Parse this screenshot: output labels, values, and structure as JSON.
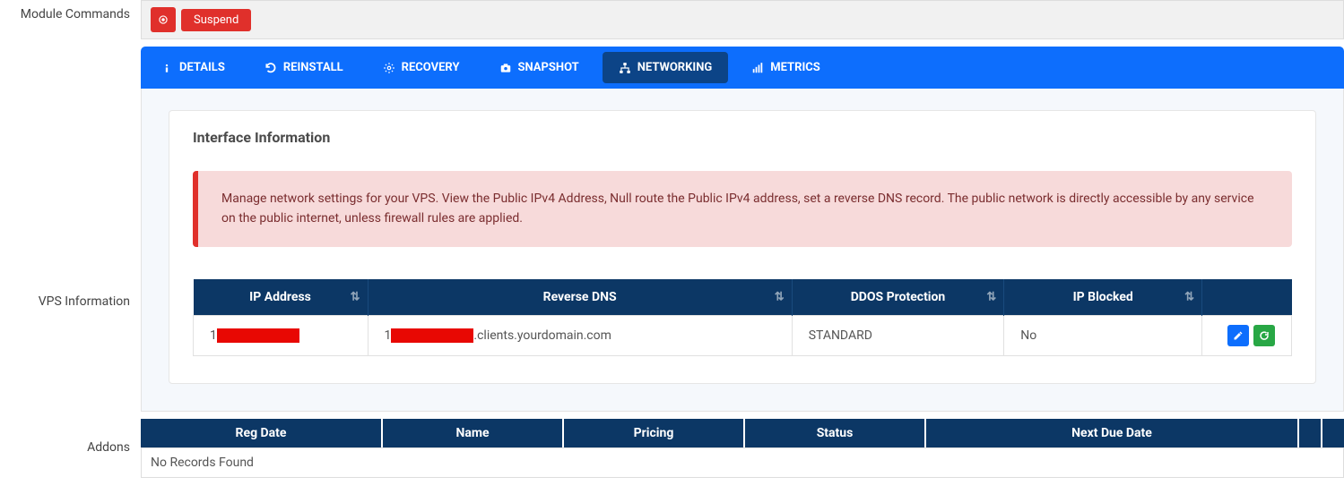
{
  "sections": {
    "module_commands": "Module Commands",
    "vps_information": "VPS Information",
    "addons": "Addons"
  },
  "commands": {
    "suspend": "Suspend"
  },
  "tabs": {
    "details": "DETAILS",
    "reinstall": "REINSTALL",
    "recovery": "RECOVERY",
    "snapshot": "SNAPSHOT",
    "networking": "NETWORKING",
    "metrics": "METRICS"
  },
  "networking": {
    "card_title": "Interface Information",
    "alert": "Manage network settings for your VPS. View the Public IPv4 Address, Null route the Public IPv4 address, set a reverse DNS record. The public network is directly accessible by any service on the public internet, unless firewall rules are applied.",
    "headers": {
      "ip": "IP Address",
      "rdns": "Reverse DNS",
      "ddos": "DDOS Protection",
      "blocked": "IP Blocked"
    },
    "row": {
      "ip_prefix": "1",
      "rdns_prefix": "1",
      "rdns_suffix": ".clients.yourdomain.com",
      "ddos": "STANDARD",
      "blocked": "No"
    }
  },
  "addons_table": {
    "headers": {
      "reg_date": "Reg Date",
      "name": "Name",
      "pricing": "Pricing",
      "status": "Status",
      "next_due": "Next Due Date"
    },
    "empty": "No Records Found"
  }
}
